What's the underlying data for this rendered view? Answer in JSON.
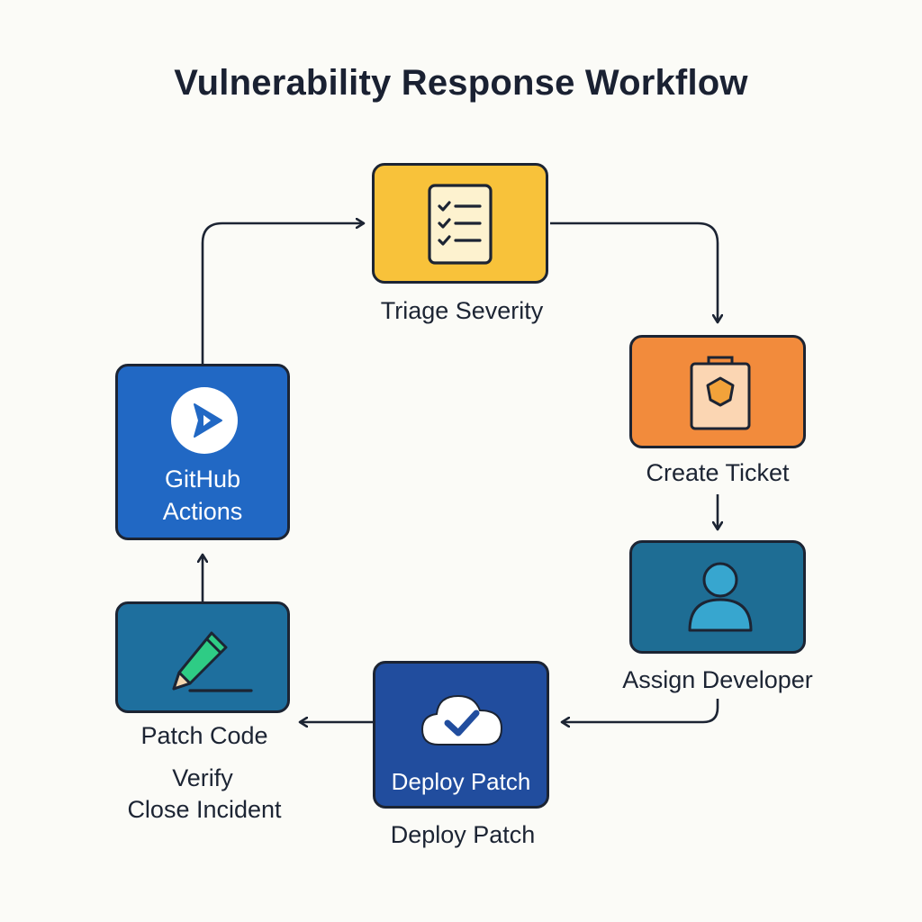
{
  "title": "Vulnerability Response Workflow",
  "colors": {
    "triage": "#f8c23a",
    "ticket": "#f28b3c",
    "assign": "#1e6d94",
    "deploy": "#214d9e",
    "patch": "#1e6f9e",
    "github": "#2168c4",
    "outline": "#1c2433"
  },
  "nodes": {
    "triage": {
      "label": "Triage Severity",
      "icon": "checklist-icon"
    },
    "ticket": {
      "label": "Create Ticket",
      "icon": "ticket-bag-icon"
    },
    "assign": {
      "label": "Assign Developer",
      "icon": "user-icon"
    },
    "deploy": {
      "inner_label": "Deploy Patch",
      "label": "Deploy Patch",
      "icon": "cloud-check-icon"
    },
    "patch": {
      "label": "Patch Code",
      "extra_lines": [
        "Verify",
        "Close Incident"
      ],
      "icon": "pencil-icon"
    },
    "github": {
      "inner_lines": [
        "GitHub",
        "Actions"
      ],
      "icon": "play-circle-icon"
    }
  }
}
